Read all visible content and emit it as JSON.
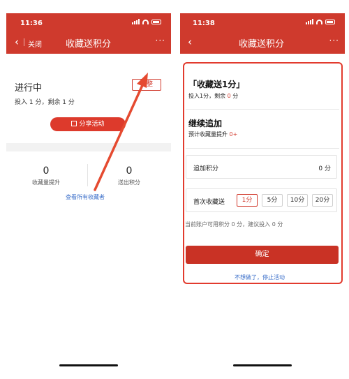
{
  "left_screen": {
    "time": "11:36",
    "back_label": "关闭",
    "nav_title": "收藏送积分",
    "more_label": "···",
    "status_title": "进行中",
    "status_sub": "投入 1 分，剩余 1 分",
    "adjust_label": "调整",
    "share_label": "分享活动",
    "stats": [
      {
        "value": "0",
        "label": "收藏量提升"
      },
      {
        "value": "0",
        "label": "送出积分"
      }
    ],
    "view_all": "查看所有收藏者"
  },
  "right_screen": {
    "time": "11:38",
    "nav_title": "收藏送积分",
    "more_label": "···",
    "activity_title": "「收藏送1分」",
    "activity_sub_prefix": "投入1分，剩余 ",
    "activity_sub_value": "0",
    "activity_sub_suffix": " 分",
    "continue_title": "继续追加",
    "continue_sub_prefix": "预计收藏量提升 ",
    "continue_sub_value": "0+",
    "add_points_label": "追加积分",
    "add_points_value": "0 分",
    "first_fav_label": "首次收藏送",
    "options": [
      "1分",
      "5分",
      "10分",
      "20分"
    ],
    "selected_option": "1分",
    "hint": "当前账户可用积分 0 分，建议投入 0 分",
    "confirm_label": "确定",
    "stop_label": "不想做了，停止活动"
  },
  "colors": {
    "brand_red": "#cf3a2d",
    "link_blue": "#3a6ec9",
    "highlight_red": "#e23b2e"
  }
}
